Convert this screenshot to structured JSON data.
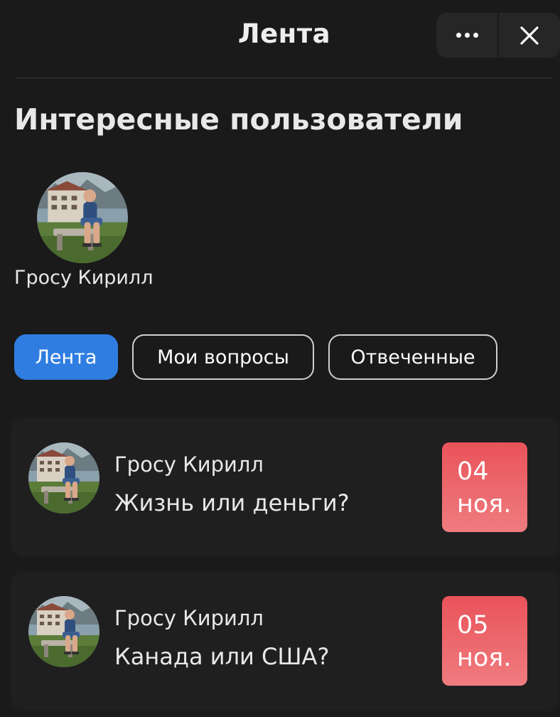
{
  "header": {
    "title": "Лента",
    "more_icon": "more-horizontal-icon",
    "close_icon": "close-icon"
  },
  "interesting_users": {
    "title": "Интересные пользователи",
    "users": [
      {
        "name": "Гросу Кирилл",
        "avatar_icon": "avatar-photo"
      }
    ]
  },
  "tabs": [
    {
      "label": "Лента",
      "active": true
    },
    {
      "label": "Мои вопросы",
      "active": false
    },
    {
      "label": "Отвеченные",
      "active": false
    }
  ],
  "feed": [
    {
      "author": "Гросу Кирилл",
      "question": "Жизнь или деньги?",
      "day": "04",
      "month": "ноя."
    },
    {
      "author": "Гросу Кирилл",
      "question": "Канада или США?",
      "day": "05",
      "month": "ноя."
    }
  ],
  "colors": {
    "background": "#1a1a1a",
    "card": "#1f1f1f",
    "accent": "#2f7de1",
    "date_badge_top": "#e9535a",
    "date_badge_bottom": "#ef7c7f"
  }
}
